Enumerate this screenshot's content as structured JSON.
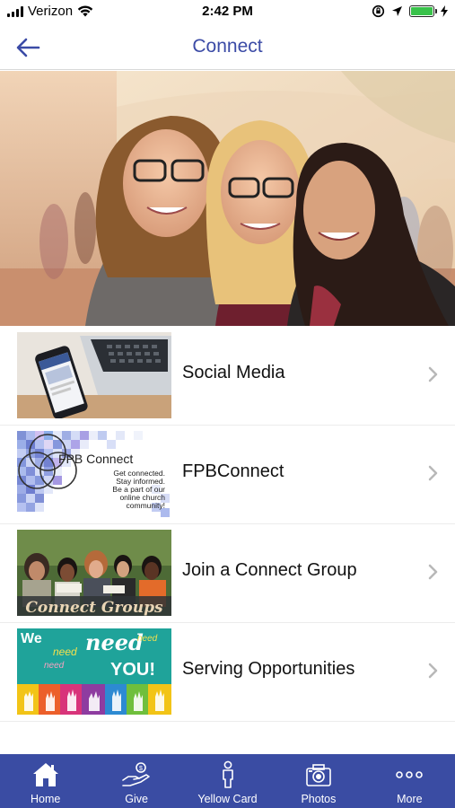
{
  "status_bar": {
    "carrier": "Verizon",
    "time": "2:42 PM"
  },
  "nav": {
    "title": "Connect"
  },
  "list": {
    "items": [
      {
        "label": "Social Media"
      },
      {
        "label": "FPBConnect"
      },
      {
        "label": "Join a Connect Group"
      },
      {
        "label": "Serving Opportunities"
      }
    ]
  },
  "thumbs": {
    "fpb_title": "FPB Connect",
    "fpb_line1": "Get connected.",
    "fpb_line2": "Stay informed.",
    "fpb_line3": "Be a part of our",
    "fpb_line4": "online church",
    "fpb_line5": "community!",
    "connect_groups": "Connect Groups",
    "we": "We",
    "need": "need",
    "you": "YOU!"
  },
  "tab_bar": {
    "tabs": [
      {
        "label": "Home",
        "icon": "home-icon"
      },
      {
        "label": "Give",
        "icon": "give-icon"
      },
      {
        "label": "Yellow Card",
        "icon": "person-icon"
      },
      {
        "label": "Photos",
        "icon": "camera-icon"
      },
      {
        "label": "More",
        "icon": "more-icon"
      }
    ]
  },
  "colors": {
    "brand_blue": "#3a4ca3",
    "title_blue": "#3b4ba6",
    "battery_green": "#39c24a"
  }
}
